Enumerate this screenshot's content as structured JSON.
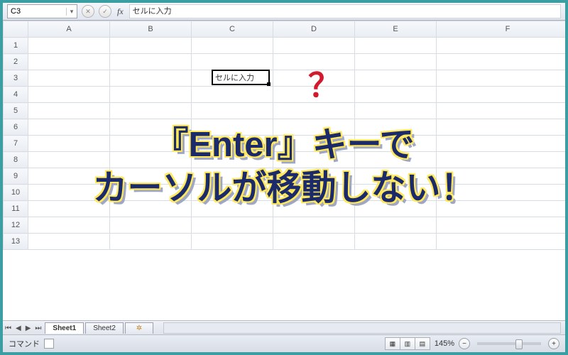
{
  "namebox": {
    "value": "C3"
  },
  "formula_bar": {
    "fx_label": "fx",
    "value": "セルに入力"
  },
  "columns": [
    "A",
    "B",
    "C",
    "D",
    "E",
    "F"
  ],
  "rows": [
    "1",
    "2",
    "3",
    "4",
    "5",
    "6",
    "7",
    "8",
    "9",
    "10",
    "11",
    "12",
    "13"
  ],
  "active": {
    "col": "C",
    "row": "3",
    "value": "セルに入力"
  },
  "overlay": {
    "question": "？",
    "line1": "『Enter』キーで",
    "line2": "カーソルが移動しない！"
  },
  "tabs": {
    "nav": [
      "⏮",
      "◀",
      "▶",
      "⏭"
    ],
    "items": [
      "Sheet1",
      "Sheet2"
    ],
    "active": 0,
    "add": "✲"
  },
  "status": {
    "mode": "コマンド",
    "zoom": "145%",
    "minus": "−",
    "plus": "+"
  },
  "viewbuttons": [
    "▦",
    "▥",
    "▤"
  ]
}
